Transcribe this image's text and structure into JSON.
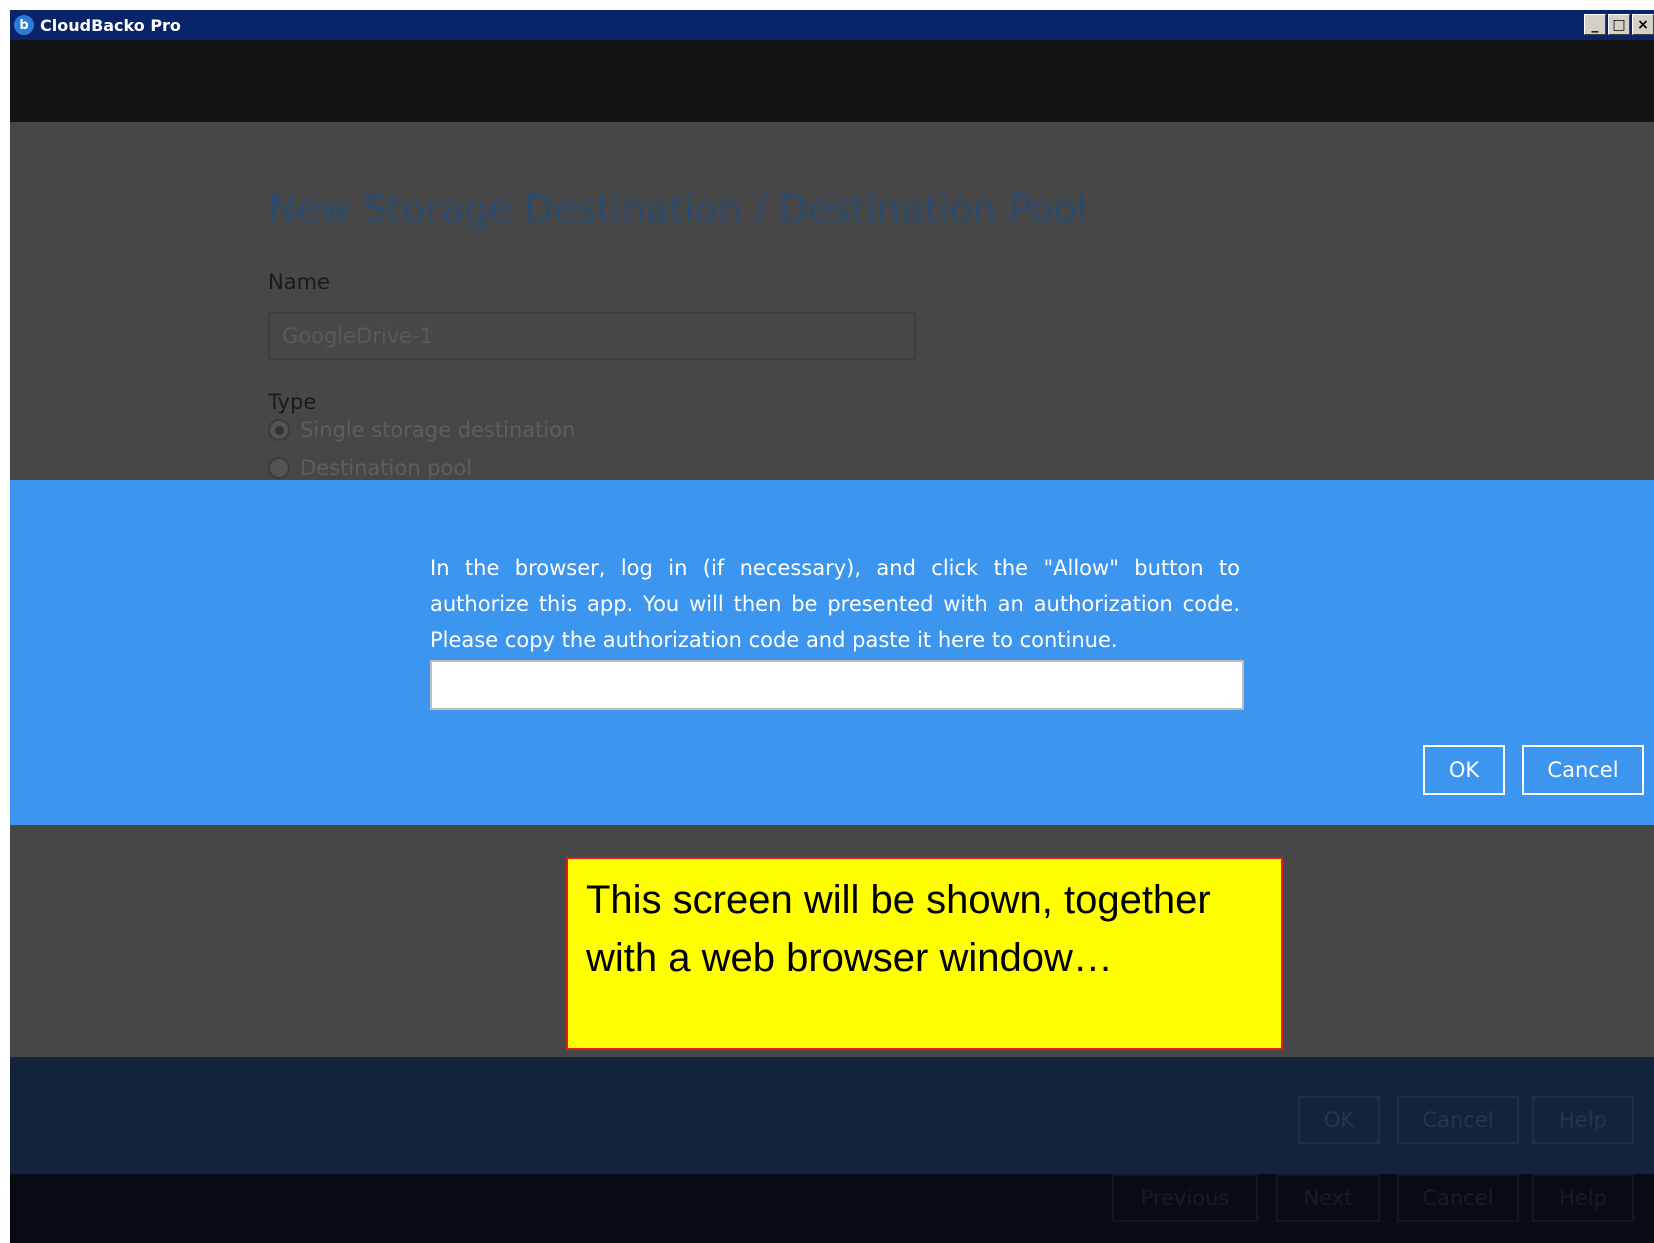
{
  "window": {
    "title": "CloudBacko Pro",
    "controls": [
      "_",
      "□",
      "×"
    ]
  },
  "form": {
    "page_title": "New Storage Destination / Destination Pool",
    "name_label": "Name",
    "name_value": "GoogleDrive-1",
    "type_label": "Type",
    "type_options": [
      "Single storage destination",
      "Destination pool"
    ],
    "selected_type": "Single storage destination"
  },
  "modal": {
    "message": "In the browser, log in (if necessary), and click the \"Allow\" button to authorize this app. You will then be presented with an authorization code. Please copy the authorization code and paste it here to continue.",
    "code_value": "",
    "ok_label": "OK",
    "cancel_label": "Cancel"
  },
  "callout": {
    "text": "This screen will be shown, together with a web browser window…"
  },
  "footer_primary": {
    "ok_label": "OK",
    "cancel_label": "Cancel",
    "help_label": "Help"
  },
  "footer_secondary": {
    "previous_label": "Previous",
    "next_label": "Next",
    "cancel_label": "Cancel",
    "help_label": "Help"
  },
  "colors": {
    "modal_bg": "#3c95ee",
    "callout_bg": "#ffff00",
    "callout_border": "#e11a1a",
    "titlebar_bg": "#0a246a"
  },
  "icons": {
    "app": "cloudbacko-logo-icon"
  }
}
